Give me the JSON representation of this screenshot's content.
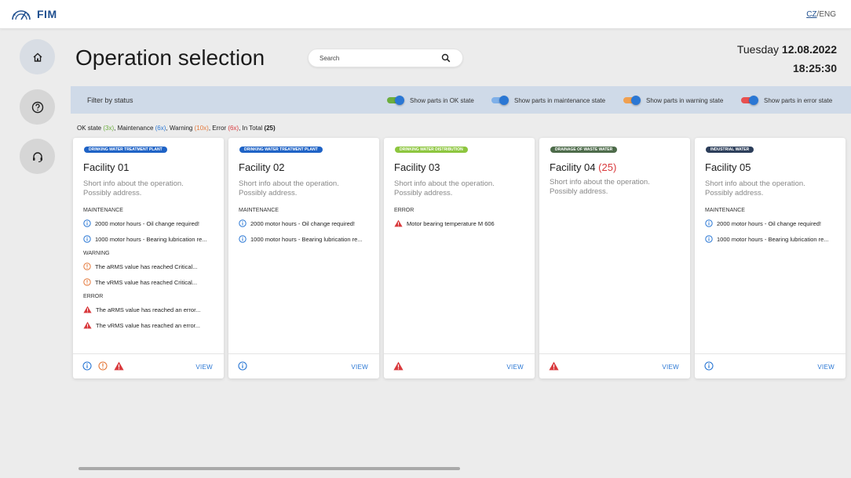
{
  "app": {
    "logo_text": "FIM"
  },
  "lang": {
    "cz": "CZ",
    "sep": "/",
    "eng": "ENG"
  },
  "nav": [
    {
      "name": "home",
      "icon": "home-icon"
    },
    {
      "name": "help",
      "icon": "question-icon"
    },
    {
      "name": "support",
      "icon": "headset-icon"
    }
  ],
  "page": {
    "title": "Operation selection"
  },
  "search": {
    "placeholder": "Search"
  },
  "datetime": {
    "day": "Tuesday",
    "date": "12.08.2022",
    "time": "18:25:30"
  },
  "filter": {
    "label": "Filter by status",
    "toggles": [
      {
        "label": "Show parts in OK state",
        "color": "#6cae3e",
        "on": true
      },
      {
        "label": "Show parts in maintenance state",
        "color": "#7fb0e8",
        "on": true
      },
      {
        "label": "Show parts in warning state",
        "color": "#f0a050",
        "on": true
      },
      {
        "label": "Show parts in error state",
        "color": "#e85050",
        "on": true
      }
    ]
  },
  "summary": {
    "ok_label": "OK state",
    "ok_count": "(3x)",
    "maint_label": "Maintenance",
    "maint_count": "(6x)",
    "warn_label": "Warning",
    "warn_count": "(10x)",
    "err_label": "Error",
    "err_count": "(6x)",
    "total_label": "In Total",
    "total_count": "(25)"
  },
  "colors": {
    "info": "#2a77d4",
    "warning": "#e57a3d",
    "error": "#d9393c",
    "link": "#2a77d4"
  },
  "cards": [
    {
      "badge": "Drinking water treatment plant",
      "badge_color": "#1f63c6",
      "title": "Facility 01",
      "count": "",
      "desc1": "Short info about the operation.",
      "desc2": "Possibly address.",
      "sections": [
        {
          "head": "Maintenance",
          "type": "info",
          "items": [
            "2000 motor hours - Oil change required!",
            "1000 motor hours - Bearing lubrication re..."
          ]
        },
        {
          "head": "Warning",
          "type": "warning",
          "items": [
            "The aRMS value has reached Critical...",
            "The vRMS value has reached Critical..."
          ]
        },
        {
          "head": "Error",
          "type": "error",
          "items": [
            "The aRMS value has reached an error...",
            "The vRMS value has reached an error..."
          ]
        }
      ],
      "foot_icons": [
        "info",
        "warning",
        "error"
      ],
      "view": "VIEW"
    },
    {
      "badge": "Drinking water treatment plant",
      "badge_color": "#1f63c6",
      "title": "Facility 02",
      "count": "",
      "desc1": "Short info about the operation.",
      "desc2": "Possibly address.",
      "sections": [
        {
          "head": "Maintenance",
          "type": "info",
          "items": [
            "2000 motor hours - Oil change required!",
            "1000 motor hours - Bearing lubrication re..."
          ]
        }
      ],
      "foot_icons": [
        "info"
      ],
      "view": "VIEW"
    },
    {
      "badge": "Drinking water distribution",
      "badge_color": "#8dc63f",
      "title": "Facility 03",
      "count": "",
      "desc1": "Short info about the operation.",
      "desc2": "Possibly address.",
      "sections": [
        {
          "head": "Error",
          "type": "error",
          "items": [
            "Motor bearing temperature M 606"
          ]
        }
      ],
      "foot_icons": [
        "error"
      ],
      "view": "VIEW"
    },
    {
      "badge": "Drainage of waste water",
      "badge_color": "#4d6b4a",
      "title": "Facility 04",
      "count": "(25)",
      "desc1": "Short info about the operation.",
      "desc2": "Possibly address.",
      "sections": [],
      "foot_icons": [
        "error"
      ],
      "view": "VIEW"
    },
    {
      "badge": "Industrial water",
      "badge_color": "#2c3e5a",
      "title": "Facility 05",
      "count": "",
      "desc1": "Short info about the operation.",
      "desc2": "Possibly address.",
      "sections": [
        {
          "head": "Maintenance",
          "type": "info",
          "items": [
            "2000 motor hours - Oil change required!",
            "1000 motor hours - Bearing lubrication re..."
          ]
        }
      ],
      "foot_icons": [
        "info"
      ],
      "view": "VIEW"
    }
  ]
}
